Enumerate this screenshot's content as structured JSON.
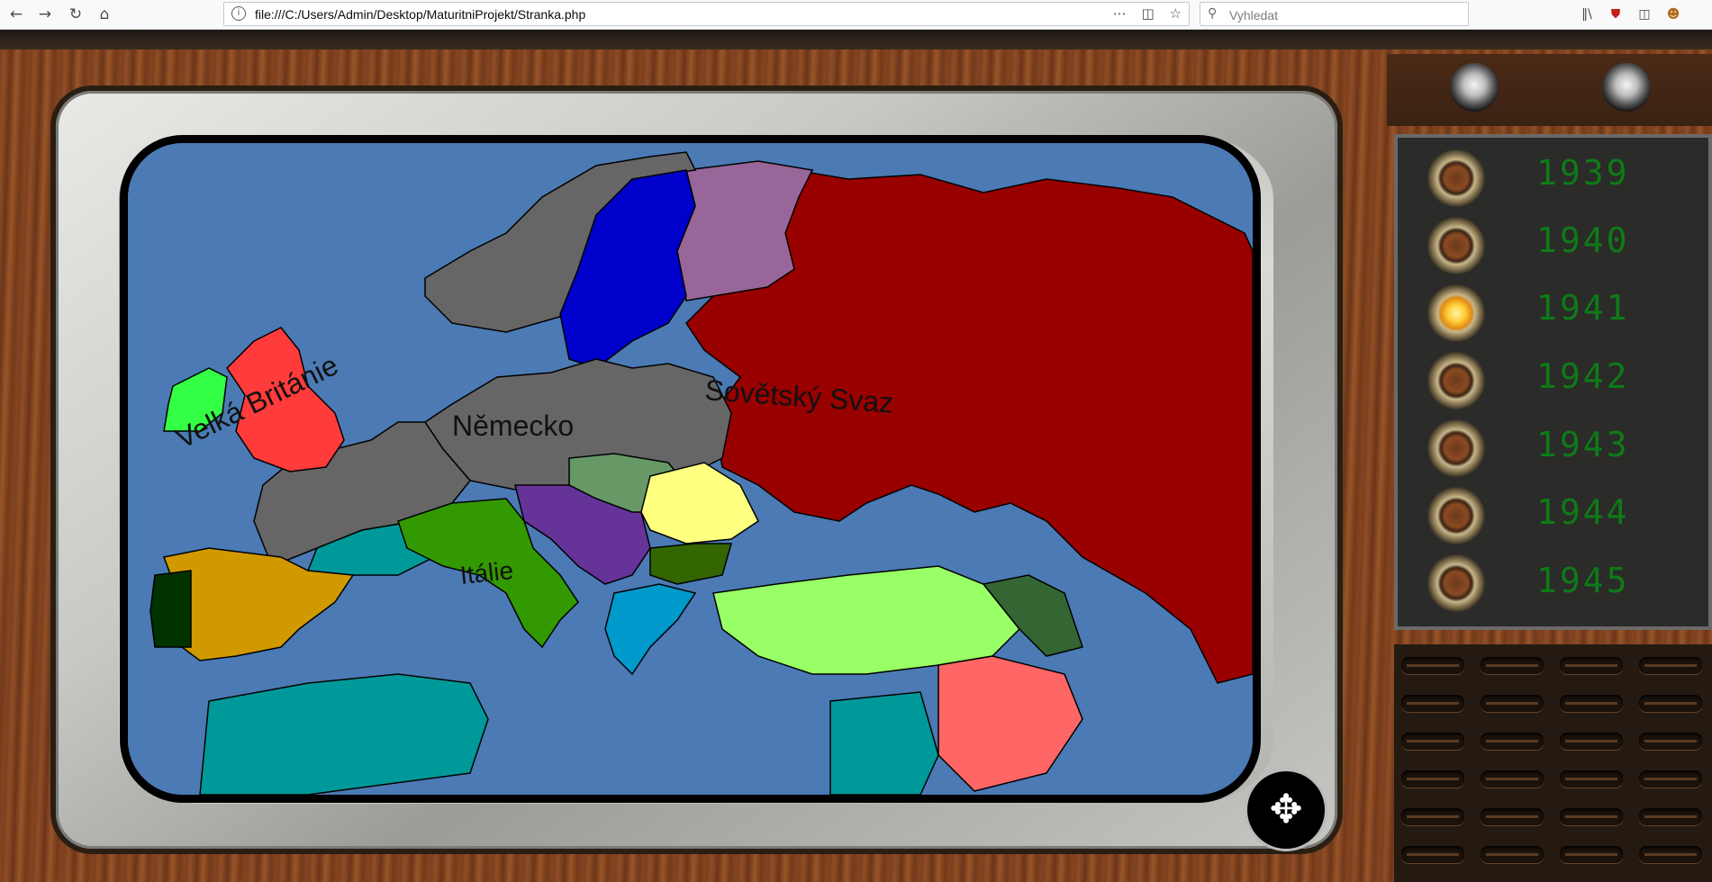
{
  "browser": {
    "url": "file:///C:/Users/Admin/Desktop/MaturitniProjekt/Stranka.php",
    "search_placeholder": "Vyhledat",
    "back_icon": "arrow-left-icon",
    "forward_icon": "arrow-right-icon",
    "reload_icon": "reload-icon",
    "home_icon": "home-icon"
  },
  "map": {
    "labels": {
      "uk": "Velká Británie",
      "germany": "Německo",
      "soviet": "Sovětský Svaz",
      "italy": "Itálie"
    },
    "colors": {
      "sea": "#4b7ab4",
      "soviet": "#990000",
      "germany": "#666666",
      "uk": "#ff3b3b",
      "ireland": "#33ff44",
      "sweden": "#0000cc",
      "finland": "#996699",
      "spain": "#d09900",
      "portugal": "#003300",
      "italy": "#339900",
      "turkey": "#99ff66",
      "greece": "#0099cc",
      "vichy": "#009999",
      "romania": "#ffff80",
      "yugoslavia": "#663399",
      "hungary": "#669966",
      "bulgaria": "#336600"
    }
  },
  "years": {
    "items": [
      "1939",
      "1940",
      "1941",
      "1942",
      "1943",
      "1944",
      "1945"
    ],
    "active": "1941"
  },
  "controls": {
    "fullscreen_icon": "fullscreen-arrows-icon"
  }
}
